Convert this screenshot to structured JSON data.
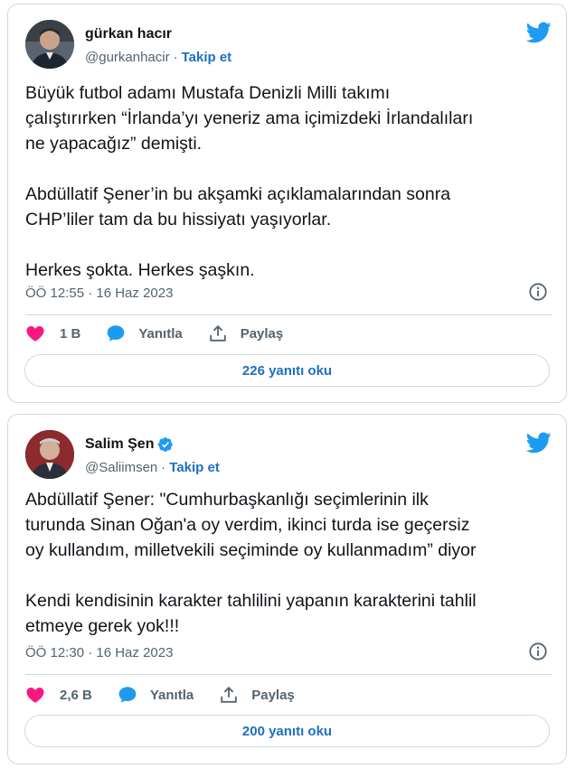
{
  "tweets": [
    {
      "display_name": "gürkan hacır",
      "handle": "@gurkanhacir",
      "separator": "·",
      "follow_label": "Takip et",
      "verified": false,
      "text": "Büyük futbol adamı Mustafa Denizli Milli takımı\nçalıştırırken “İrlanda’yı yeneriz ama içimizdeki İrlandalıları\nne yapacağız” demişti.\n\nAbdüllatif Şener’in bu akşamki açıklamalarından sonra\nCHP’liler tam da bu hissiyatı yaşıyorlar.\n\nHerkes şokta. Herkes şaşkın.",
      "timestamp": "ÖÖ 12:55 · 16 Haz 2023",
      "likes": "1 B",
      "reply_label": "Yanıtla",
      "share_label": "Paylaş",
      "replies_button": "226 yanıtı oku"
    },
    {
      "display_name": "Salim Şen",
      "handle": "@Saliimsen",
      "separator": "·",
      "follow_label": "Takip et",
      "verified": true,
      "text": "Abdüllatif Şener: \"Cumhurbaşkanlığı seçimlerinin ilk\nturunda Sinan Oğan'a oy verdim, ikinci turda ise geçersiz\noy kullandım, milletvekili seçiminde oy kullanmadım” diyor\n\nKendi kendisinin karakter tahlilini yapanın karakterini tahlil\netmeye gerek yok!!!",
      "timestamp": "ÖÖ 12:30 · 16 Haz 2023",
      "likes": "2,6 B",
      "reply_label": "Yanıtla",
      "share_label": "Paylaş",
      "replies_button": "200 yanıtı oku"
    }
  ],
  "colors": {
    "like": "#f91880",
    "twitter_blue": "#1d9bf0",
    "link_blue": "#1d6fc3",
    "muted": "#536471",
    "border": "#cfd9de"
  },
  "icons": {
    "brand": "twitter-bird-icon",
    "like": "heart-icon",
    "reply": "speech-bubble-icon",
    "share": "share-upload-icon",
    "info": "info-icon",
    "verified": "verified-badge-icon"
  }
}
